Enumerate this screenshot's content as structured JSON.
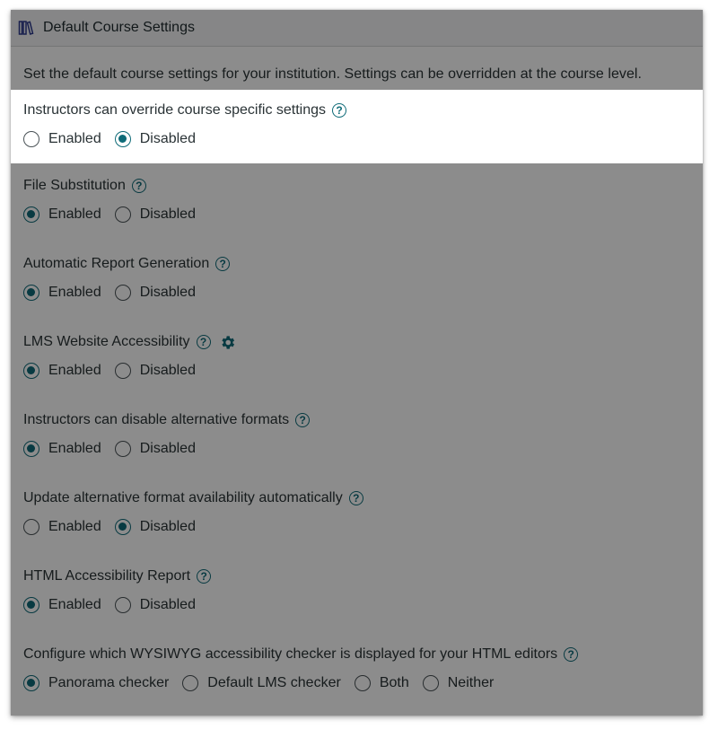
{
  "header": {
    "title": "Default Course Settings",
    "icon": "book-icon"
  },
  "description": "Set the default course settings for your institution. Settings can be overridden at the course level.",
  "settings": [
    {
      "label": "Instructors can override course specific settings",
      "options": [
        "Enabled",
        "Disabled"
      ],
      "selected": 1,
      "highlighted": true
    },
    {
      "label": "File Substitution",
      "options": [
        "Enabled",
        "Disabled"
      ],
      "selected": 0
    },
    {
      "label": "Automatic Report Generation",
      "options": [
        "Enabled",
        "Disabled"
      ],
      "selected": 0
    },
    {
      "label": "LMS Website Accessibility",
      "options": [
        "Enabled",
        "Disabled"
      ],
      "selected": 0,
      "gear": true
    },
    {
      "label": "Instructors can disable alternative formats",
      "options": [
        "Enabled",
        "Disabled"
      ],
      "selected": 0
    },
    {
      "label": "Update alternative format availability automatically",
      "options": [
        "Enabled",
        "Disabled"
      ],
      "selected": 1
    },
    {
      "label": "HTML Accessibility Report",
      "options": [
        "Enabled",
        "Disabled"
      ],
      "selected": 0
    },
    {
      "label": "Configure which WYSIWYG accessibility checker is displayed for your HTML editors",
      "options": [
        "Panorama checker",
        "Default LMS checker",
        "Both",
        "Neither"
      ],
      "selected": 0
    }
  ],
  "colors": {
    "accent": "#0f6b78",
    "overlay": "rgba(0,0,0,0.45)"
  }
}
